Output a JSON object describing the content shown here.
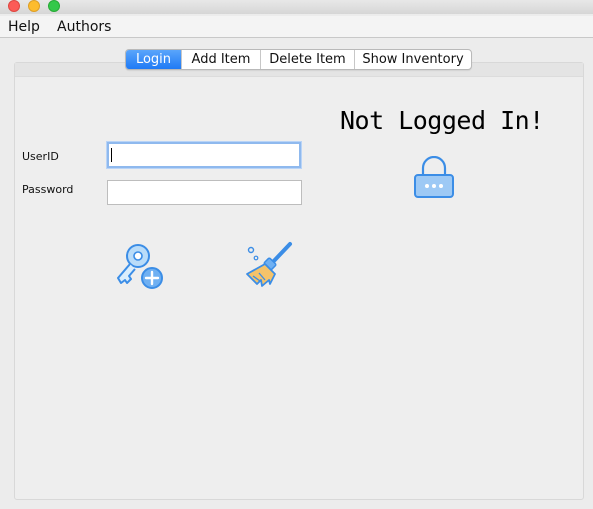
{
  "menu": {
    "items": [
      "Help",
      "Authors"
    ]
  },
  "tabs": [
    {
      "label": "Login",
      "active": true
    },
    {
      "label": "Add Item",
      "active": false
    },
    {
      "label": "Delete Item",
      "active": false
    },
    {
      "label": "Show Inventory",
      "active": false
    }
  ],
  "login_form": {
    "userid_label": "UserID",
    "password_label": "Password",
    "userid_value": "",
    "password_value": ""
  },
  "status": {
    "text": "Not Logged In!"
  },
  "icons": {
    "login_button": "key-add-icon",
    "clear_button": "broom-icon",
    "status_icon": "lock-icon"
  },
  "colors": {
    "accent": "#1f7af5",
    "icon_blue": "#3b8de6",
    "icon_fill": "#9dc9f5"
  }
}
